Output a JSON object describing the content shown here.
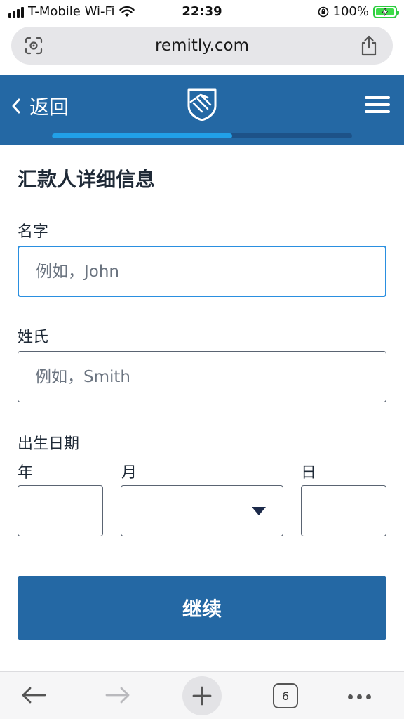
{
  "status_bar": {
    "carrier": "T-Mobile Wi-Fi",
    "time": "22:39",
    "battery": "100%"
  },
  "browser": {
    "url": "remitly.com"
  },
  "header": {
    "back_label": "返回",
    "progress_fraction": 0.6
  },
  "form": {
    "title": "汇款人详细信息",
    "first_name": {
      "label": "名字",
      "placeholder": "例如，John",
      "value": ""
    },
    "last_name": {
      "label": "姓氏",
      "placeholder": "例如，Smith",
      "value": ""
    },
    "dob": {
      "label": "出生日期",
      "year_label": "年",
      "month_label": "月",
      "day_label": "日"
    },
    "continue_label": "继续"
  },
  "toolbar": {
    "tab_count": "6"
  },
  "colors": {
    "brand_blue": "#2468a4",
    "progress_fill": "#21a0e8",
    "focus_border": "#2a8fe0"
  }
}
